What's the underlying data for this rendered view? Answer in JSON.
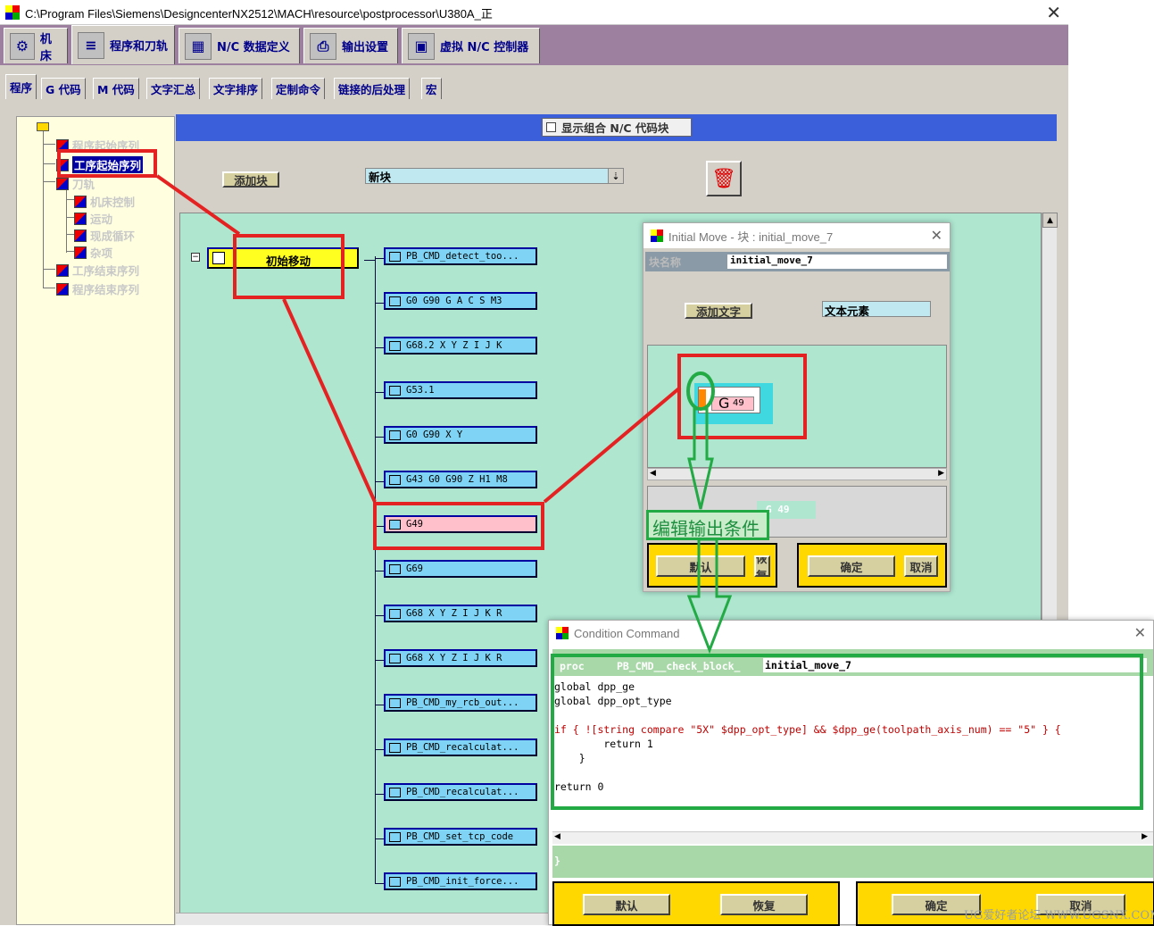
{
  "window": {
    "title": "C:\\Program Files\\Siemens\\DesigncenterNX2512\\MACH\\resource\\postprocessor\\U380A_正",
    "close_glyph": "✕"
  },
  "top_tabs": [
    {
      "label": "机床",
      "icon": "machine-icon"
    },
    {
      "label": "程序和刀轨",
      "icon": "toolpath-icon"
    },
    {
      "label": "N/C 数据定义",
      "icon": "nc-data-icon"
    },
    {
      "label": "输出设置",
      "icon": "printer-icon"
    },
    {
      "label": "虚拟 N/C 控制器",
      "icon": "controller-icon"
    }
  ],
  "sub_tabs": [
    "程序",
    "G 代码",
    "M 代码",
    "文字汇总",
    "文字排序",
    "定制命令",
    "链接的后处理",
    "宏"
  ],
  "tree": {
    "items": [
      "程序起始序列",
      "工序起始序列",
      "刀轨",
      "机床控制",
      "运动",
      "现成循环",
      "杂项",
      "工序结束序列",
      "程序结束序列"
    ]
  },
  "toolbar": {
    "show_combined_label": "显示组合 N/C 代码块",
    "add_block_label": "添加块",
    "new_block_value": "新块"
  },
  "marker": {
    "label": "初始移动"
  },
  "blocks": [
    "PB_CMD_detect_too...",
    "G0 G90 G A C S M3",
    "G68.2 X Y Z I J K",
    "G53.1",
    "G0 G90 X Y",
    "G43 G0 G90 Z H1 M8",
    "G49",
    "G69",
    "G68 X Y Z I J K R",
    "G68 X Y Z I J K R",
    "PB_CMD_my_rcb_out...",
    "PB_CMD_recalculat...",
    "PB_CMD_recalculat...",
    "PB_CMD_set_tcp_code",
    "PB_CMD_init_force..."
  ],
  "initial_move_dialog": {
    "title": "Initial Move  -  块 : initial_move_7",
    "block_name_label": "块名称",
    "block_name_value": "initial_move_7",
    "add_text_label": "添加文字",
    "text_element_value": "文本元素",
    "word_letter": "G",
    "word_value": "49",
    "preview_text": "G    49",
    "default_label": "默认",
    "restore_label": "恢复",
    "ok_label": "确定",
    "cancel_label": "取消"
  },
  "annotation": {
    "edit_condition_label": "编辑输出条件"
  },
  "condition_dialog": {
    "title": "Condition Command",
    "proc_keyword": "proc",
    "proc_name": "PB_CMD__check_block_",
    "proc_suffix": "initial_move_7",
    "code_lines": [
      "global dpp_ge",
      "global dpp_opt_type",
      "",
      "if { ![string compare \"5X\" $dpp_opt_type] && $dpp_ge(toolpath_axis_num) == \"5\" } {",
      "        return 1",
      "    }",
      "",
      "return 0"
    ],
    "closing_brace": "}",
    "default_label": "默认",
    "restore_label": "恢复",
    "ok_label": "确定",
    "cancel_label": "取消"
  },
  "watermark": "UG爱好者论坛 WWW.UGSNX.COM",
  "colors": {
    "accent_red": "#e52222",
    "accent_green": "#22aa44",
    "canvas": "#aee6d0",
    "block": "#7fd4f5",
    "selected_block": "#ffc0cb",
    "marker": "#ffff20",
    "tab_strip": "#9d7fa0",
    "blue_band": "#3b5fdb"
  }
}
